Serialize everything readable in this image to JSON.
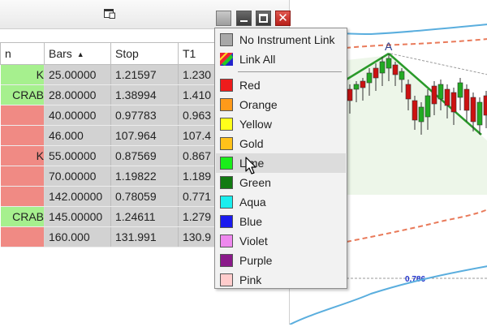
{
  "table": {
    "columns": [
      "n",
      "Bars",
      "Stop",
      "T1"
    ],
    "sort_indicator": "▲",
    "rows": [
      {
        "name": "K",
        "bars": "25.00000",
        "stop": "1.21597",
        "t1": "1.230",
        "color": "#a6f08e"
      },
      {
        "name": "CRAB",
        "bars": "28.00000",
        "stop": "1.38994",
        "t1": "1.410",
        "color": "#a6f08e"
      },
      {
        "name": "",
        "bars": "40.00000",
        "stop": "0.97783",
        "t1": "0.963",
        "color": "#f08a84"
      },
      {
        "name": "",
        "bars": "46.000",
        "stop": "107.964",
        "t1": "107.4",
        "color": "#f08a84"
      },
      {
        "name": "K",
        "bars": "55.00000",
        "stop": "0.87569",
        "t1": "0.867",
        "color": "#f08a84"
      },
      {
        "name": "",
        "bars": "70.00000",
        "stop": "1.19822",
        "t1": "1.189",
        "color": "#f08a84"
      },
      {
        "name": "",
        "bars": "142.00000",
        "stop": "0.78059",
        "t1": "0.771",
        "color": "#f08a84"
      },
      {
        "name": "CRAB",
        "bars": "145.00000",
        "stop": "1.24611",
        "t1": "1.279",
        "color": "#a6f08e"
      },
      {
        "name": "",
        "bars": "160.000",
        "stop": "131.991",
        "t1": "130.9",
        "color": "#f08a84"
      }
    ]
  },
  "window_controls": {
    "close_glyph": "✕"
  },
  "menu": {
    "top_items": [
      {
        "label": "No Instrument Link",
        "icon": "gray-square-icon",
        "color": "#a8a8a8"
      },
      {
        "label": "Link All",
        "icon": "multicolor-link-icon",
        "color": ""
      }
    ],
    "colors": [
      {
        "label": "Red",
        "color": "#ee1c1c"
      },
      {
        "label": "Orange",
        "color": "#ff9a1a"
      },
      {
        "label": "Yellow",
        "color": "#ffff1a"
      },
      {
        "label": "Gold",
        "color": "#ffc21a"
      },
      {
        "label": "Lime",
        "color": "#1aee1a"
      },
      {
        "label": "Green",
        "color": "#117a11"
      },
      {
        "label": "Aqua",
        "color": "#1aeeee"
      },
      {
        "label": "Blue",
        "color": "#1a1aee"
      },
      {
        "label": "Violet",
        "color": "#ee88ee"
      },
      {
        "label": "Purple",
        "color": "#8a1a8a"
      },
      {
        "label": "Pink",
        "color": "#ffcccc"
      }
    ],
    "highlighted": "Lime"
  },
  "chart": {
    "pattern_label": "A",
    "fib_label": "0.786"
  }
}
